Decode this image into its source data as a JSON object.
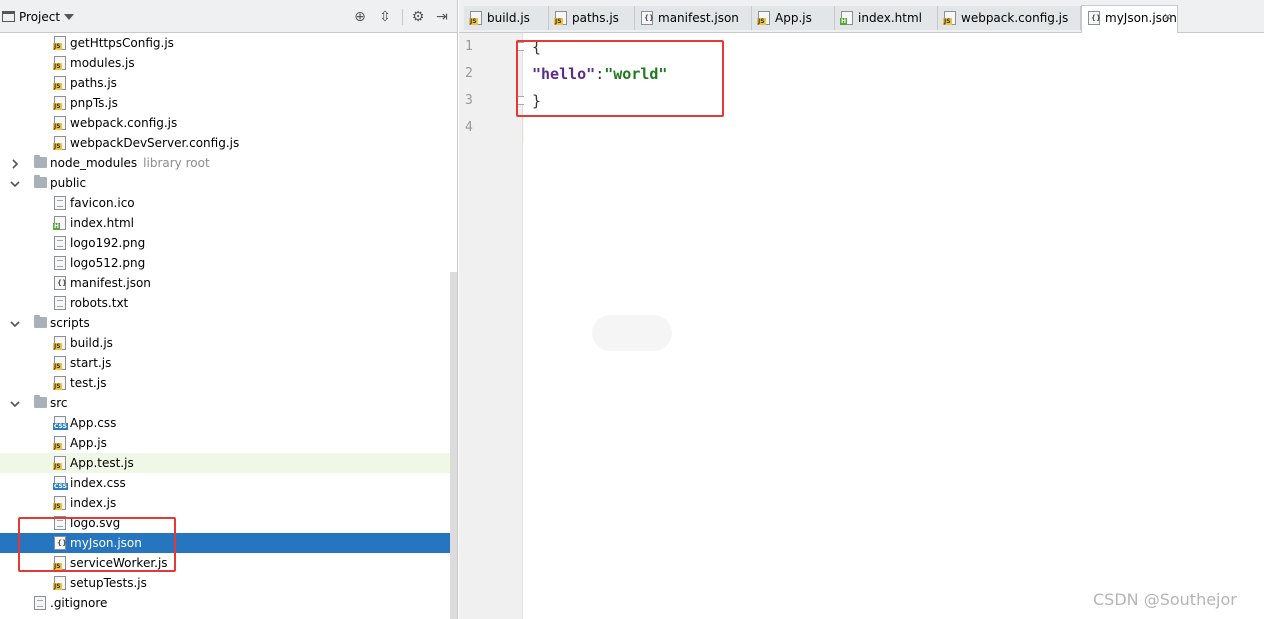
{
  "project_panel": {
    "title": "Project"
  },
  "tree": [
    {
      "label": "getHttpsConfig.js",
      "kind": "js"
    },
    {
      "label": "modules.js",
      "kind": "js"
    },
    {
      "label": "paths.js",
      "kind": "js"
    },
    {
      "label": "pnpTs.js",
      "kind": "js"
    },
    {
      "label": "webpack.config.js",
      "kind": "js"
    },
    {
      "label": "webpackDevServer.config.js",
      "kind": "js"
    },
    {
      "label": "node_modules",
      "kind": "folder",
      "sub": "library root",
      "expanded": false
    },
    {
      "label": "public",
      "kind": "folder",
      "expanded": true
    },
    {
      "label": "favicon.ico",
      "kind": "text"
    },
    {
      "label": "index.html",
      "kind": "html"
    },
    {
      "label": "logo192.png",
      "kind": "text"
    },
    {
      "label": "logo512.png",
      "kind": "text"
    },
    {
      "label": "manifest.json",
      "kind": "json"
    },
    {
      "label": "robots.txt",
      "kind": "text"
    },
    {
      "label": "scripts",
      "kind": "folder",
      "expanded": true
    },
    {
      "label": "build.js",
      "kind": "js"
    },
    {
      "label": "start.js",
      "kind": "js"
    },
    {
      "label": "test.js",
      "kind": "js"
    },
    {
      "label": "src",
      "kind": "folder",
      "expanded": true
    },
    {
      "label": "App.css",
      "kind": "css"
    },
    {
      "label": "App.js",
      "kind": "js"
    },
    {
      "label": "App.test.js",
      "kind": "js"
    },
    {
      "label": "index.css",
      "kind": "css"
    },
    {
      "label": "index.js",
      "kind": "js"
    },
    {
      "label": "logo.svg",
      "kind": "text"
    },
    {
      "label": "myJson.json",
      "kind": "json"
    },
    {
      "label": "serviceWorker.js",
      "kind": "js"
    },
    {
      "label": "setupTests.js",
      "kind": "js"
    },
    {
      "label": ".gitignore",
      "kind": "text"
    }
  ],
  "tabs": [
    {
      "label": "build.js",
      "kind": "js"
    },
    {
      "label": "paths.js",
      "kind": "js"
    },
    {
      "label": "manifest.json",
      "kind": "json"
    },
    {
      "label": "App.js",
      "kind": "js"
    },
    {
      "label": "index.html",
      "kind": "html"
    },
    {
      "label": "webpack.config.js",
      "kind": "js"
    },
    {
      "label": "myJson.json",
      "kind": "json",
      "active": true,
      "close": "×"
    }
  ],
  "editor": {
    "line_numbers": [
      "1",
      "2",
      "3",
      "4"
    ],
    "line1": "{",
    "key": "\"hello\"",
    "colon": ":",
    "value": "\"world\"",
    "line3": "}"
  },
  "watermark": "CSDN @Southejor",
  "colors": {
    "selection": "#2675bf",
    "annotation_red": "#e53935",
    "json_key": "#5b2a8c",
    "json_string": "#1f7a1f"
  }
}
